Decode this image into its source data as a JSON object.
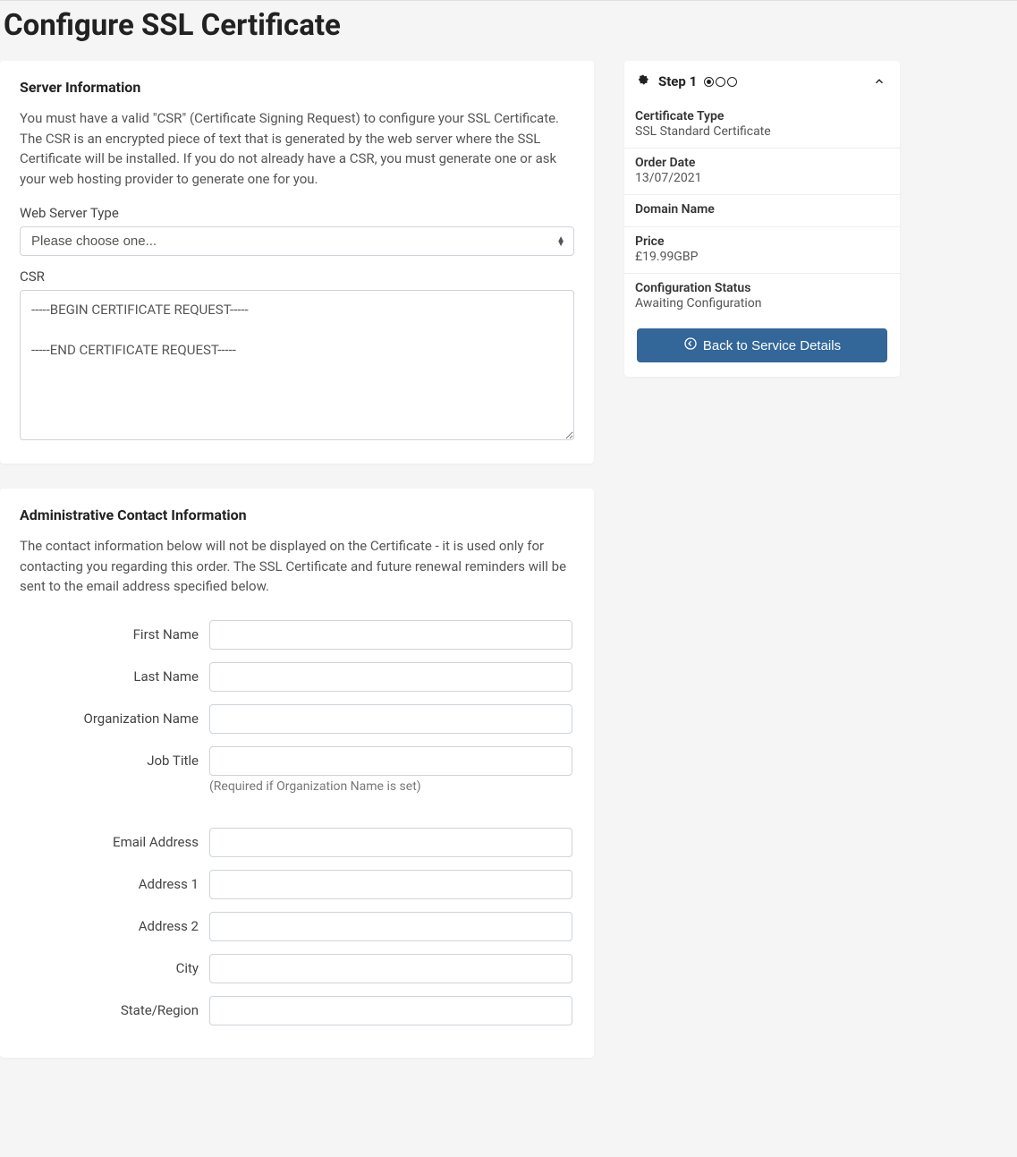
{
  "page_title": "Configure SSL Certificate",
  "server_info": {
    "heading": "Server Information",
    "description": "You must have a valid \"CSR\" (Certificate Signing Request) to configure your SSL Certificate. The CSR is an encrypted piece of text that is generated by the web server where the SSL Certificate will be installed. If you do not already have a CSR, you must generate one or ask your web hosting provider to generate one for you.",
    "server_type_label": "Web Server Type",
    "server_type_selected": "Please choose one...",
    "csr_label": "CSR",
    "csr_value": "-----BEGIN CERTIFICATE REQUEST-----\n\n-----END CERTIFICATE REQUEST-----"
  },
  "admin_contact": {
    "heading": "Administrative Contact Information",
    "description": "The contact information below will not be displayed on the Certificate - it is used only for contacting you regarding this order. The SSL Certificate and future renewal reminders will be sent to the email address specified below.",
    "fields": {
      "first_name": "First Name",
      "last_name": "Last Name",
      "org_name": "Organization Name",
      "job_title": "Job Title",
      "job_title_help": "(Required if Organization Name is set)",
      "email": "Email Address",
      "address1": "Address 1",
      "address2": "Address 2",
      "city": "City",
      "state": "State/Region"
    }
  },
  "sidebar": {
    "step_label": "Step 1",
    "items": [
      {
        "label": "Certificate Type",
        "value": "SSL Standard Certificate"
      },
      {
        "label": "Order Date",
        "value": "13/07/2021"
      },
      {
        "label": "Domain Name",
        "value": ""
      },
      {
        "label": "Price",
        "value": "£19.99GBP"
      },
      {
        "label": "Configuration Status",
        "value": "Awaiting Configuration"
      }
    ],
    "back_button": "Back to Service Details"
  }
}
